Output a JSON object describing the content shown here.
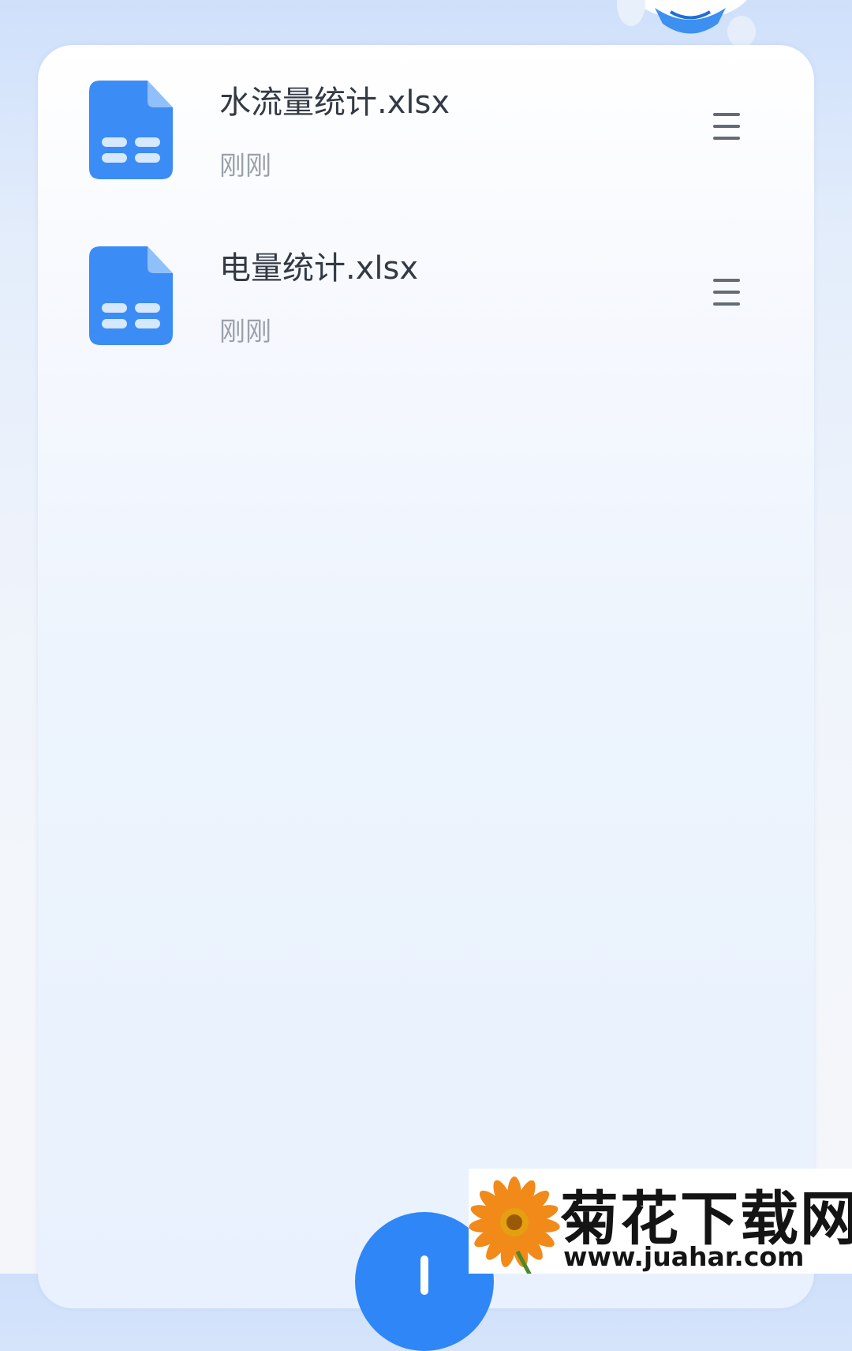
{
  "colors": {
    "accent": "#2f86f6",
    "file_icon": "#3b8cf5",
    "file_name_text": "#333a44",
    "file_time_text": "#9aa1aa",
    "menu_icon": "#646b76"
  },
  "files": [
    {
      "name": "水流量统计.xlsx",
      "time": "刚刚",
      "icon": "spreadsheet-icon",
      "menu_icon": "menu-icon"
    },
    {
      "name": "电量统计.xlsx",
      "time": "刚刚",
      "icon": "spreadsheet-icon",
      "menu_icon": "menu-icon"
    }
  ],
  "fab": {
    "icon": "plus-icon"
  },
  "watermark": {
    "title": "菊花下载网",
    "url": "www.juahar.com",
    "logo": "flower-logo"
  }
}
